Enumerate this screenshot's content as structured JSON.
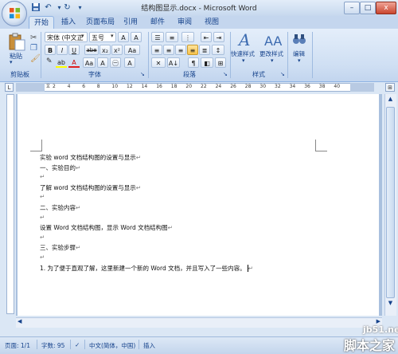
{
  "window": {
    "title": "结构图显示.docx - Microsoft Word",
    "controls": [
      "–",
      "□",
      "x"
    ]
  },
  "quick_access": [
    "save-icon",
    "undo-icon",
    "redo-icon",
    "customize-icon"
  ],
  "tabs": [
    {
      "label": "开始",
      "active": true
    },
    {
      "label": "插入"
    },
    {
      "label": "页面布局"
    },
    {
      "label": "引用"
    },
    {
      "label": "邮件"
    },
    {
      "label": "审阅"
    },
    {
      "label": "视图"
    }
  ],
  "ribbon": {
    "clipboard": {
      "label": "剪贴板",
      "paste_label": "粘贴"
    },
    "font": {
      "label": "字体",
      "font_name": "宋体 (中文正",
      "font_size": "五号",
      "row2": [
        "B",
        "I",
        "U",
        "abe",
        "x₂",
        "x²",
        "Aa"
      ],
      "row3": [
        "A",
        "ab",
        "A",
        "Aa",
        "A",
        "A"
      ]
    },
    "paragraph": {
      "label": "段落"
    },
    "styles": {
      "label": "样式",
      "quick_styles": "快速样式",
      "change_styles": "更改样式"
    },
    "editing": {
      "label": "编辑"
    }
  },
  "ruler_numbers": [
    "2",
    "4",
    "6",
    "8",
    "10",
    "12",
    "14",
    "16",
    "18",
    "20",
    "22",
    "24",
    "26",
    "28",
    "30",
    "32",
    "34",
    "36",
    "38",
    "40"
  ],
  "document": {
    "paragraphs": [
      "实验  word 文档结构图的设置与显示",
      "一、实验目的",
      "",
      "了解 word 文档结构图的设置与显示",
      "",
      "二、实验内容",
      "",
      "设置 Word 文档结构图，显示 Word 文档结构图",
      "",
      "三、实验步骤",
      "",
      "1.   为了便于直观了解，这里新建一个新的 Word 文档，并且写入了一些内容。"
    ],
    "paragraph_mark": "↵"
  },
  "statusbar": {
    "page": "页面: 1/1",
    "words": "字数: 95",
    "language": "中文(简体，中国)",
    "mode": "插入"
  },
  "watermark": {
    "line1": "jb51.net",
    "line2": "脚本之家"
  }
}
